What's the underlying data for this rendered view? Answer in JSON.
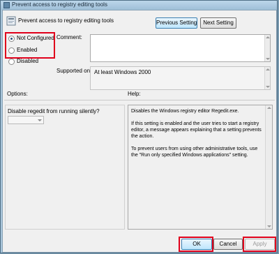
{
  "window": {
    "title": "Prevent access to registry editing tools"
  },
  "header": {
    "policy_name": "Prevent access to registry editing tools"
  },
  "nav": {
    "previous_label": "Previous Setting",
    "next_label": "Next Setting"
  },
  "state": {
    "options": [
      {
        "label": "Not Configured",
        "checked": true
      },
      {
        "label": "Enabled",
        "checked": false
      },
      {
        "label": "Disabled",
        "checked": false
      }
    ]
  },
  "comment": {
    "label": "Comment:",
    "value": ""
  },
  "supported": {
    "label": "Supported on:",
    "value": "At least Windows 2000"
  },
  "options_pane": {
    "label": "Options:",
    "question": "Disable regedit from running silently?",
    "dropdown_value": ""
  },
  "help_pane": {
    "label": "Help:",
    "paragraphs": [
      "Disables the Windows registry editor Regedit.exe.",
      "If this setting is enabled and the user tries to start a registry editor, a message appears explaining that a setting prevents the action.",
      "To prevent users from using other administrative tools, use the \"Run only specified Windows applications\" setting."
    ]
  },
  "footer": {
    "ok_label": "OK",
    "cancel_label": "Cancel",
    "apply_label": "Apply"
  },
  "colors": {
    "highlight": "#e0001b",
    "window_frame": "#a9c6db",
    "dialog_bg": "#f0f0f0"
  }
}
